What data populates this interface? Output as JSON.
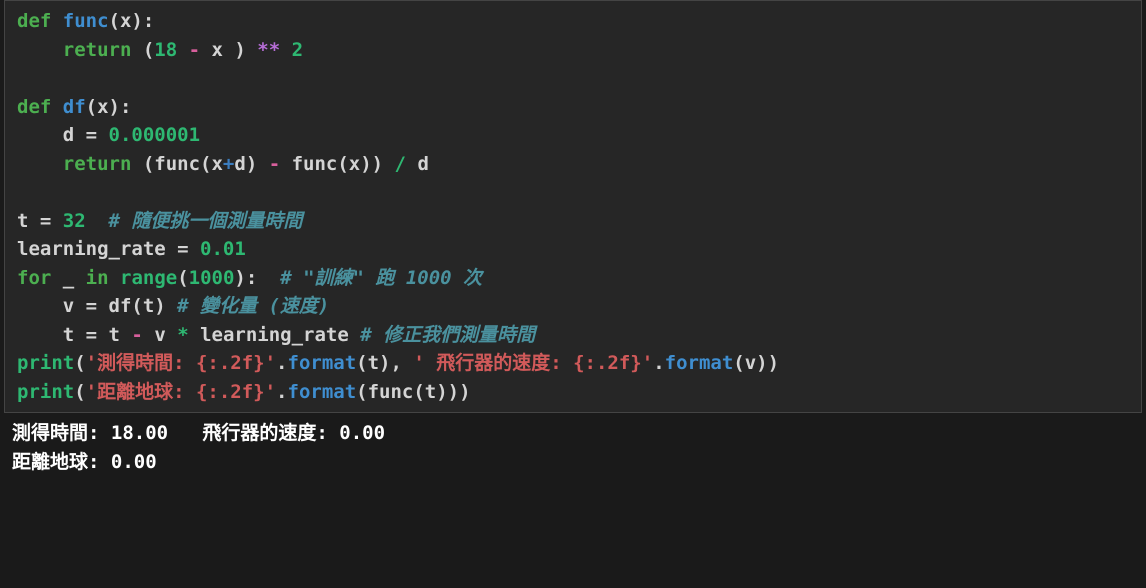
{
  "code": {
    "l1_def": "def",
    "l1_func": "func",
    "l1_params": "(x)",
    "l1_colon": ":",
    "l2_return": "return",
    "l2_open": " (",
    "l2_18": "18",
    "l2_minus": " - ",
    "l2_x": "x )",
    "l2_pow": " ** ",
    "l2_2": "2",
    "l4_def": "def",
    "l4_df": "df",
    "l4_params": "(x)",
    "l4_colon": ":",
    "l5_d": "    d ",
    "l5_eq": "=",
    "l5_val": " 0.000001",
    "l6_return": "return",
    "l6_open": " (func(x",
    "l6_plus": "+",
    "l6_d": "d) ",
    "l6_minus": "-",
    "l6_funcx": " func(x)) ",
    "l6_div": "/",
    "l6_d2": " d",
    "l8_t": "t ",
    "l8_eq": "=",
    "l8_32": " 32",
    "l8_comment": "  # 隨便挑一個測量時間",
    "l9_lr": "learning_rate ",
    "l9_eq": "=",
    "l9_val": " 0.01",
    "l10_for": "for",
    "l10_under": " _ ",
    "l10_in": "in",
    "l10_sp": " ",
    "l10_range": "range",
    "l10_args": "(",
    "l10_1000": "1000",
    "l10_close": "):",
    "l10_comment": "  # \"訓練\" 跑 1000 次",
    "l11_v": "    v ",
    "l11_eq": "=",
    "l11_dft": " df(t) ",
    "l11_comment": "# 變化量 (速度)",
    "l12_t": "    t ",
    "l12_eq": "=",
    "l12_tspace": " t ",
    "l12_minus": "-",
    "l12_v": " v ",
    "l12_star": "*",
    "l12_lr": " learning_rate ",
    "l12_comment": "# 修正我們測量時間",
    "l13_print": "print",
    "l13_open": "(",
    "l13_str1": "'測得時間: {:.2f}'",
    "l13_dot1": ".",
    "l13_format1": "format",
    "l13_args1": "(t), ",
    "l13_str2": "' 飛行器的速度: {:.2f}'",
    "l13_dot2": ".",
    "l13_format2": "format",
    "l13_args2": "(v))",
    "l14_print": "print",
    "l14_open": "(",
    "l14_str": "'距離地球: {:.2f}'",
    "l14_dot": ".",
    "l14_format": "format",
    "l14_args": "(func(t)))"
  },
  "output": {
    "line1": "測得時間: 18.00   飛行器的速度: 0.00",
    "line2": "距離地球: 0.00"
  }
}
